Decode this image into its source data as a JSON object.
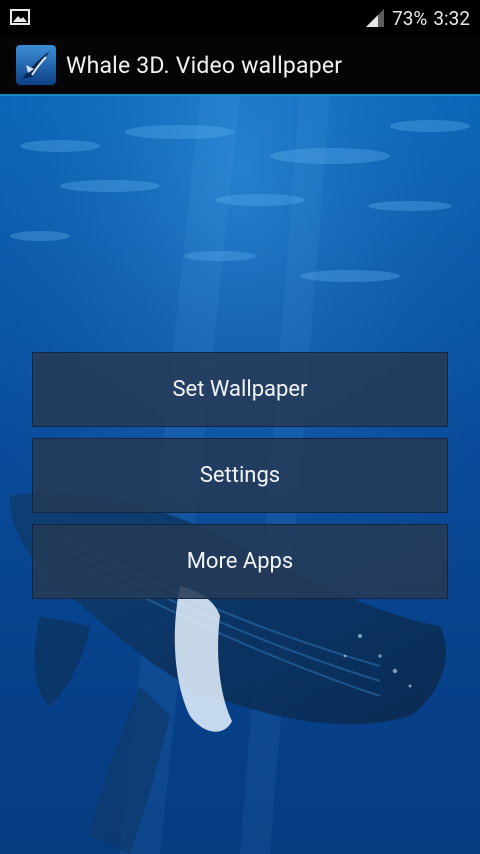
{
  "status_bar": {
    "left_icon": "image-notification-icon",
    "signal_icon": "cell-signal-icon",
    "battery": "73%",
    "time": "3:32"
  },
  "action_bar": {
    "app_icon": "whale-app-icon",
    "title": "Whale 3D. Video wallpaper",
    "accent_color": "#1b88c9"
  },
  "menu": {
    "set_wallpaper_label": "Set Wallpaper",
    "settings_label": "Settings",
    "more_apps_label": "More Apps"
  },
  "colors": {
    "water_top": "#0a67b8",
    "water_bottom": "#063b80",
    "button_bg": "#263a56"
  }
}
